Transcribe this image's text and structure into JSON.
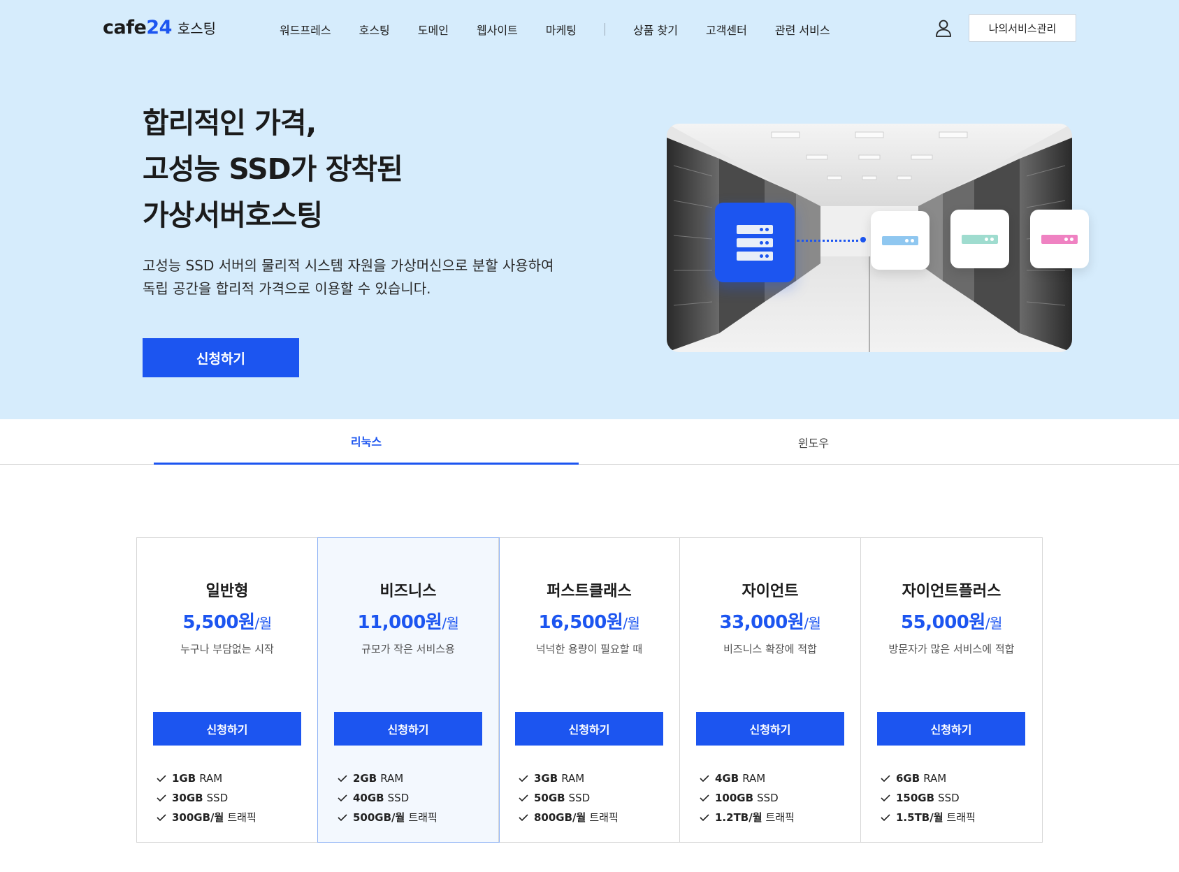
{
  "header": {
    "logo_text": "cafe",
    "logo_num": "24",
    "logo_sub": "호스팅",
    "menu": [
      "워드프레스",
      "호스팅",
      "도메인",
      "웹사이트",
      "마케팅"
    ],
    "menu_right": [
      "상품 찾기",
      "고객센터",
      "관련 서비스"
    ],
    "manage_button": "나의서비스관리"
  },
  "hero": {
    "title_lines": [
      "합리적인 가격,",
      "고성능 SSD가 장착된",
      "가상서버호스팅"
    ],
    "desc_lines": [
      "고성능 SSD 서버의 물리적 시스템 자원을 가상머신으로 분할 사용하여",
      "독립 공간을 합리적 가격으로 이용할 수 있습니다."
    ],
    "cta": "신청하기"
  },
  "tabs": [
    {
      "label": "리눅스",
      "active": true
    },
    {
      "label": "윈도우",
      "active": false
    }
  ],
  "plans": [
    {
      "name": "일반형",
      "price": "5,500원",
      "unit": "/월",
      "desc": "누구나 부담없는 시작",
      "button": "신청하기",
      "features": [
        {
          "value": "1GB",
          "label": "RAM"
        },
        {
          "value": "30GB",
          "label": "SSD"
        },
        {
          "value": "300GB/월",
          "label": "트래픽"
        }
      ]
    },
    {
      "name": "비즈니스",
      "price": "11,000원",
      "unit": "/월",
      "desc": "규모가 작은 서비스용",
      "button": "신청하기",
      "features": [
        {
          "value": "2GB",
          "label": "RAM"
        },
        {
          "value": "40GB",
          "label": "SSD"
        },
        {
          "value": "500GB/월",
          "label": "트래픽"
        }
      ]
    },
    {
      "name": "퍼스트클래스",
      "price": "16,500원",
      "unit": "/월",
      "desc": "넉넉한 용량이 필요할 때",
      "button": "신청하기",
      "features": [
        {
          "value": "3GB",
          "label": "RAM"
        },
        {
          "value": "50GB",
          "label": "SSD"
        },
        {
          "value": "800GB/월",
          "label": "트래픽"
        }
      ]
    },
    {
      "name": "자이언트",
      "price": "33,000원",
      "unit": "/월",
      "desc": "비즈니스 확장에 적합",
      "button": "신청하기",
      "features": [
        {
          "value": "4GB",
          "label": "RAM"
        },
        {
          "value": "100GB",
          "label": "SSD"
        },
        {
          "value": "1.2TB/월",
          "label": "트래픽"
        }
      ]
    },
    {
      "name": "자이언트플러스",
      "price": "55,000원",
      "unit": "/월",
      "desc": "방문자가 많은 서비스에 적합",
      "button": "신청하기",
      "features": [
        {
          "value": "6GB",
          "label": "RAM"
        },
        {
          "value": "150GB",
          "label": "SSD"
        },
        {
          "value": "1.5TB/월",
          "label": "트래픽"
        }
      ]
    }
  ],
  "colors": {
    "accent": "#1c55f0",
    "hero_bg": "#d6ecfc",
    "mini_blue": "#8fc7f0",
    "mini_green": "#9fdccf",
    "mini_pink": "#ef82c2"
  },
  "icons": {
    "user": "user-icon",
    "check": "check-icon",
    "server": "server-icon"
  }
}
